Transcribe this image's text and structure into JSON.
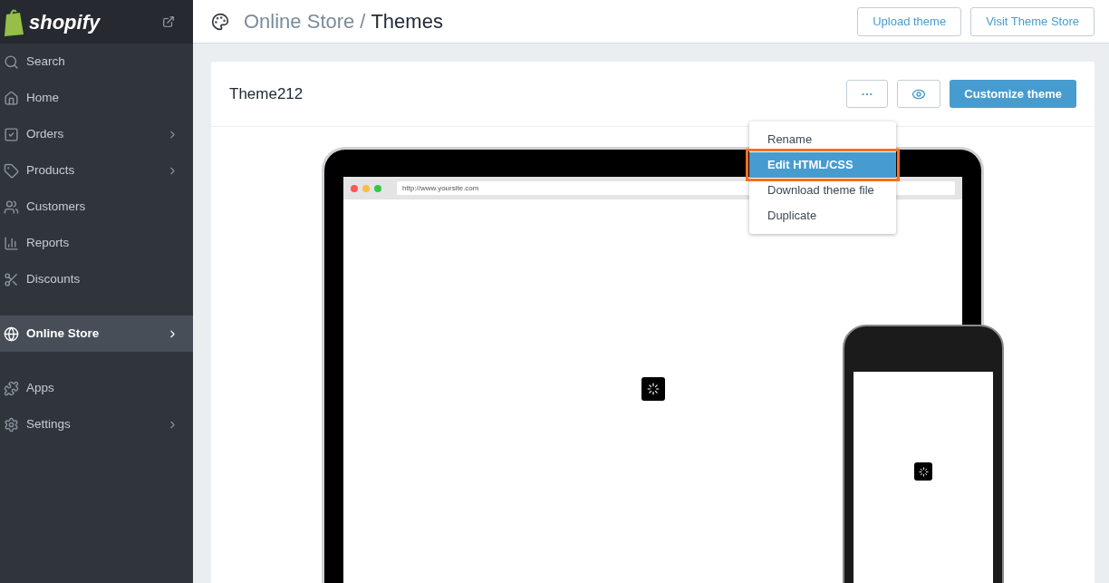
{
  "sidebar": {
    "logo": "shopify",
    "groups": [
      [
        {
          "label": "Search",
          "chevron": false,
          "selected": false
        },
        {
          "label": "Home",
          "chevron": false,
          "selected": false
        },
        {
          "label": "Orders",
          "chevron": true,
          "selected": false
        },
        {
          "label": "Products",
          "chevron": true,
          "selected": false
        },
        {
          "label": "Customers",
          "chevron": false,
          "selected": false
        },
        {
          "label": "Reports",
          "chevron": false,
          "selected": false
        },
        {
          "label": "Discounts",
          "chevron": false,
          "selected": false
        }
      ],
      [
        {
          "label": "Online Store",
          "chevron": true,
          "selected": true
        }
      ],
      [
        {
          "label": "Apps",
          "chevron": false,
          "selected": false
        },
        {
          "label": "Settings",
          "chevron": true,
          "selected": false
        }
      ]
    ]
  },
  "header": {
    "breadcrumb": "Online Store",
    "separator": "/",
    "title": "Themes",
    "buttons": [
      "Upload theme",
      "Visit Theme Store"
    ]
  },
  "theme_card": {
    "name": "Theme212",
    "more_button": "···",
    "customize_button": "Customize theme",
    "url": "http://www.yoursite.com"
  },
  "menu": [
    {
      "label": "Rename",
      "selected": false,
      "outlined": false
    },
    {
      "label": "Edit HTML/CSS",
      "selected": true,
      "outlined": true
    },
    {
      "label": "Download theme file",
      "selected": false,
      "outlined": false
    },
    {
      "label": "Duplicate",
      "selected": false,
      "outlined": false
    }
  ]
}
